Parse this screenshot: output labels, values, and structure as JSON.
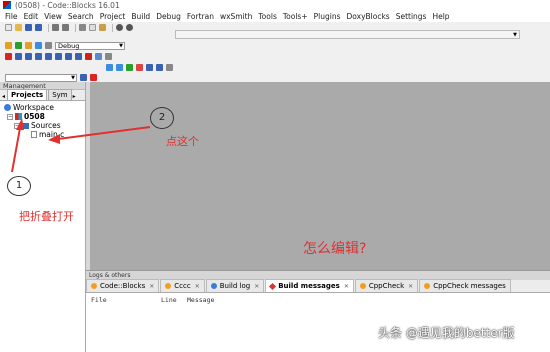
{
  "window": {
    "title": "(0508) - Code::Blocks 16.01"
  },
  "menu": [
    "File",
    "Edit",
    "View",
    "Search",
    "Project",
    "Build",
    "Debug",
    "Fortran",
    "wxSmith",
    "Tools",
    "Tools+",
    "Plugins",
    "DoxyBlocks",
    "Settings",
    "Help"
  ],
  "toolbar": {
    "build_target": "Debug"
  },
  "management": {
    "title": "Management",
    "tab_prev": "◂",
    "tabs": [
      "Projects",
      "Sym"
    ],
    "tab_next": "▸",
    "tree": {
      "workspace": "Workspace",
      "project": "0508",
      "folder": "Sources",
      "file": "main.c"
    }
  },
  "logs": {
    "title": "Logs & others",
    "tabs": [
      "Code::Blocks",
      "Cccc",
      "Build log",
      "Build messages",
      "CppCheck",
      "CppCheck messages"
    ],
    "columns": [
      "File",
      "Line",
      "Message"
    ]
  },
  "annotations": {
    "step1_number": "1",
    "step1_text": "把折叠打开",
    "step2_number": "2",
    "step2_text": "点这个",
    "question": "怎么编辑?",
    "watermark": "头条 @遇见我的better版"
  },
  "colors": {
    "annotation_red": "#e03030",
    "editor_bg": "#aaaaaa"
  }
}
